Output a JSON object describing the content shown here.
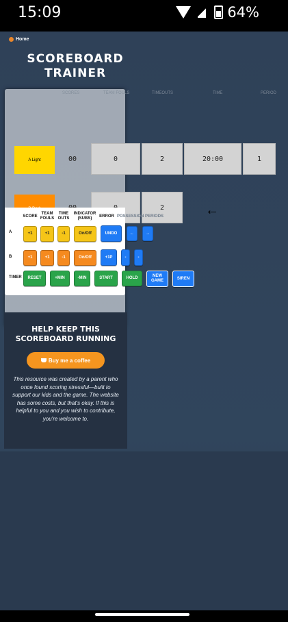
{
  "status": {
    "time": "15:09",
    "battery": "64%"
  },
  "nav": {
    "home": "Home"
  },
  "title": {
    "line1": "SCOREBOARD",
    "line2": "TRAINER"
  },
  "board": {
    "headers": [
      "SCORES",
      "TEAM FOULS",
      "TIMEOUTS",
      "TIME",
      "PERIOD"
    ],
    "rows": [
      {
        "team": "A Light",
        "team_color": "#ffd600",
        "score": "00",
        "fouls": "0",
        "timeouts": "2",
        "time": "20:00",
        "period": "1"
      },
      {
        "team": "B Dark",
        "team_color": "#ff8c00",
        "score": "00",
        "fouls": "0",
        "timeouts": "2"
      }
    ],
    "possession_arrow": "←"
  },
  "controls": {
    "headers": {
      "score": "SCORE",
      "team_fouls": "TEAM FOULS",
      "time_outs": "TIME OUTS",
      "indicator": "INDICATOR (SUBS)",
      "error": "ERROR",
      "possession": "POSSESSION",
      "periods": "PERIODS"
    },
    "row_a": {
      "label": "A",
      "score": "+1",
      "fouls": "+1",
      "timeouts": "-1",
      "indicator": "On/Off",
      "error": "UNDO",
      "poss_left": "←",
      "poss_right": "→"
    },
    "row_b": {
      "label": "B",
      "score": "+1",
      "fouls": "+1",
      "timeouts": "-1",
      "indicator": "On/Off",
      "error": "+1P",
      "poss_left": "-",
      "poss_right": "-"
    },
    "timer": {
      "label": "TIMER",
      "reset": "RESET",
      "plus_min": "+MIN",
      "minus_min": "-MIN",
      "start": "START",
      "hold": "HOLD",
      "new_game": "NEW GAME",
      "siren": "SIREN"
    }
  },
  "help": {
    "title": "HELP KEEP THIS SCOREBOARD RUNNING",
    "button": "Buy me a coffee",
    "text": "This resource was created by a parent who once found scoring stressful—built to support our kids and the game. The website has some costs, but that's okay. If this is helpful to you and you wish to contribute, you're welcome to."
  }
}
